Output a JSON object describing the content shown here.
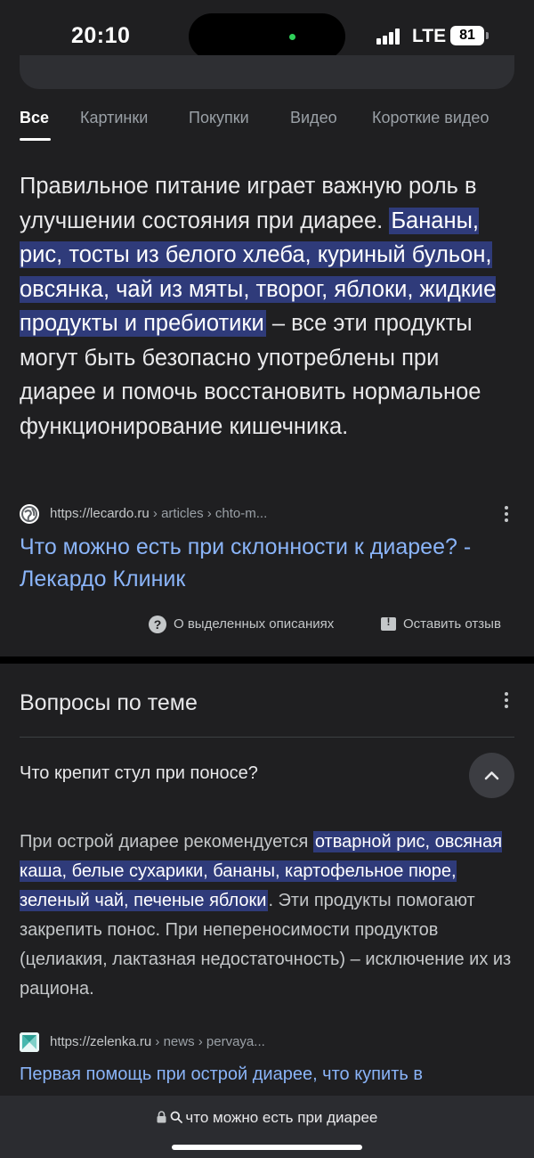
{
  "status_bar": {
    "time": "20:10",
    "network": "LTE",
    "battery": "81"
  },
  "tabs": [
    {
      "label": "Все"
    },
    {
      "label": "Картинки"
    },
    {
      "label": "Покупки"
    },
    {
      "label": "Видео"
    },
    {
      "label": "Короткие видео"
    }
  ],
  "featured_snippet": {
    "text_before": "Правильное питание играет важную роль в улучшении состояния при диарее. ",
    "text_highlight": "Бананы, рис, тосты из белого хлеба, куриный бульон, овсянка, чай из мяты, творог, яблоки, жидкие продукты и пребиотики",
    "text_after": " – все эти продукты могут быть безопасно употреблены при диарее и помочь восстановить нормальное функционирование кишечника.",
    "source_url": "https://lecardo.ru",
    "source_path": " › articles › chto-m...",
    "link_title": "Что можно есть при склонности к диарее? - Лекардо Клиник",
    "about_label": "О выделенных описаниях",
    "feedback_label": "Оставить отзыв"
  },
  "related_questions": {
    "title": "Вопросы по теме",
    "question": "Что крепит стул при поносе?",
    "answer_before": "При острой диарее рекомендуется ",
    "answer_highlight": "отварной рис, овсяная каша, белые сухарики, бананы, картофельное пюре, зеленый чай, печеные яблоки",
    "answer_after": ". Эти продукты помогают закрепить понос. При непереносимости продуктов (целиакия, лактазная недостаточность) – исключение их из рациона.",
    "source_url": "https://zelenka.ru",
    "source_path": " › news › pervaya...",
    "link_title": "Первая помощь при острой диарее, что купить в"
  },
  "address_bar": {
    "query": "что можно есть при диарее"
  },
  "colors": {
    "background": "#1f1f21",
    "highlight": "#2f3b7a",
    "link": "#8ab4f8"
  }
}
